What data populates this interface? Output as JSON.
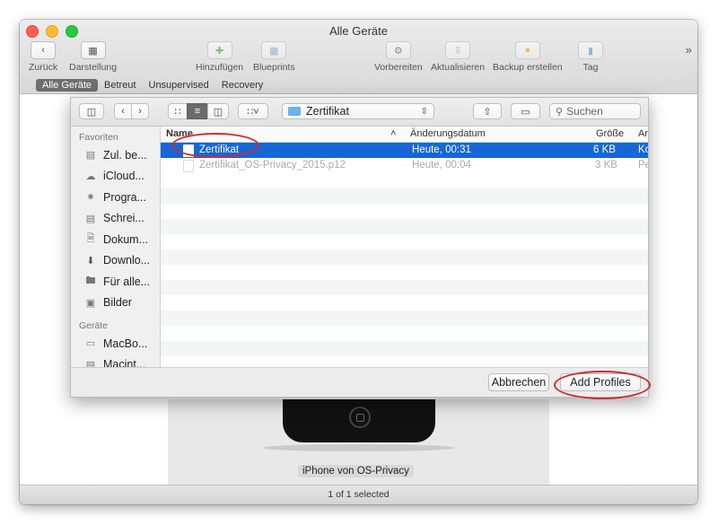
{
  "window": {
    "title": "Alle Geräte"
  },
  "toolbar": {
    "back": "Zurück",
    "view": "Darstellung",
    "add": "Hinzufügen",
    "blueprints": "Blueprints",
    "prepare": "Vorbereiten",
    "update": "Aktualisieren",
    "backup": "Backup erstellen",
    "tag": "Tag",
    "more": "»"
  },
  "filters": [
    "Alle Geräte",
    "Betreut",
    "Unsupervised",
    "Recovery"
  ],
  "sheet": {
    "path_folder": "Zertifikat",
    "search_placeholder": "Suchen",
    "sidebar": {
      "favorites_heading": "Favoriten",
      "favorites": [
        "Zul. be...",
        "iCloud...",
        "Progra...",
        "Schrei...",
        "Dokum...",
        "Downlo...",
        "Für alle...",
        "Bilder"
      ],
      "devices_heading": "Geräte",
      "devices": [
        "MacBo...",
        "Macint..."
      ]
    },
    "columns": {
      "name": "Name",
      "date": "Änderungsdatum",
      "size": "Größe",
      "kind": "Ar"
    },
    "files": [
      {
        "name": "Zertifikat",
        "date": "Heute, 00:31",
        "size": "6 KB",
        "kind": "Ko"
      },
      {
        "name": "Zertifikat_OS-Privacy_2015.p12",
        "date": "Heute, 00:04",
        "size": "3 KB",
        "kind": "Pe"
      }
    ],
    "cancel": "Abbrechen",
    "confirm": "Add Profiles"
  },
  "device": {
    "label": "iPhone von OS-Privacy"
  },
  "status": "1 of 1 selected",
  "colors": {
    "selection": "#1667d6",
    "annotation": "#d22b2b"
  }
}
